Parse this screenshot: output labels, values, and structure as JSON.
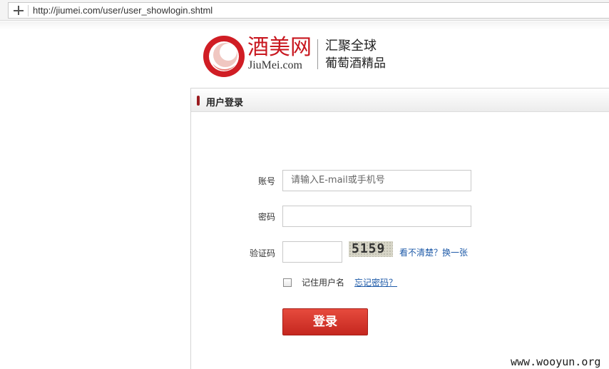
{
  "browser": {
    "url": "http://jiumei.com/user/user_showlogin.shtml"
  },
  "logo": {
    "name": "酒美网",
    "domain": "JiuMei.com",
    "slogan_line1": "汇聚全球",
    "slogan_line2": "葡萄酒精品",
    "brand_color": "#c8171f"
  },
  "panel": {
    "title": "用户登录"
  },
  "form": {
    "account_label": "账号",
    "account_placeholder": "请输入E-mail或手机号",
    "password_label": "密码",
    "password_value": "",
    "captcha_label": "验证码",
    "captcha_value": "",
    "captcha_image_text": "5159",
    "refresh_captcha_link": "看不清楚？换一张",
    "remember_label": "记住用户名",
    "remember_checked": false,
    "forgot_link": "忘记密码？",
    "submit_label": "登录",
    "accent_color": "#d93a2e"
  },
  "watermark": "www.wooyun.org"
}
